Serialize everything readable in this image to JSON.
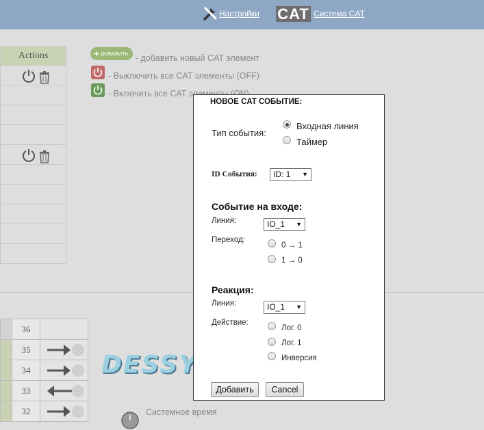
{
  "header": {
    "settings_label": "Настройки",
    "cat_logo": "CAT",
    "cat_system_label": "Система CAT",
    "settings_icon": "tools-icon"
  },
  "left_table": {
    "actions_header": "Actions"
  },
  "legend": {
    "add_pill_label": "ДОБАВИТЬ",
    "add_text": "- добавить новый CAT элемент",
    "off_text": "- Выключить все CAT элементы (OFF)",
    "on_text": "- Включить все CAT элементы (ON)"
  },
  "lines": {
    "rows": [
      {
        "num": "36",
        "direction": "none"
      },
      {
        "num": "35",
        "direction": "right"
      },
      {
        "num": "34",
        "direction": "right"
      },
      {
        "num": "33",
        "direction": "left"
      },
      {
        "num": "32",
        "direction": "right"
      }
    ]
  },
  "brand": "DESSY",
  "system_time_label": "Системное время",
  "modal": {
    "title": "НОВОЕ CAT СОБЫТИЕ:",
    "event_type_label": "Тип события:",
    "event_type_options": [
      "Входная линия",
      "Таймер"
    ],
    "event_type_selected": "Входная линия",
    "event_id_label": "ID События:",
    "event_id_value": "ID: 1",
    "input_section_title": "Событие на входе:",
    "input_line_label": "Линия:",
    "input_line_value": "IO_1",
    "transition_label": "Переход:",
    "transition_options": [
      "0 → 1",
      "1 → 0"
    ],
    "reaction_title": "Реакция:",
    "reaction_line_label": "Линия:",
    "reaction_line_value": "IO_1",
    "action_label": "Действие:",
    "action_options": [
      "Лог. 0",
      "Лог. 1",
      "Инверсия"
    ],
    "add_button": "Добавить",
    "cancel_button": "Cancel"
  },
  "colors": {
    "topbar": "#8ea7c4",
    "table_header": "#c9d3b4",
    "add_green": "#9db876"
  }
}
